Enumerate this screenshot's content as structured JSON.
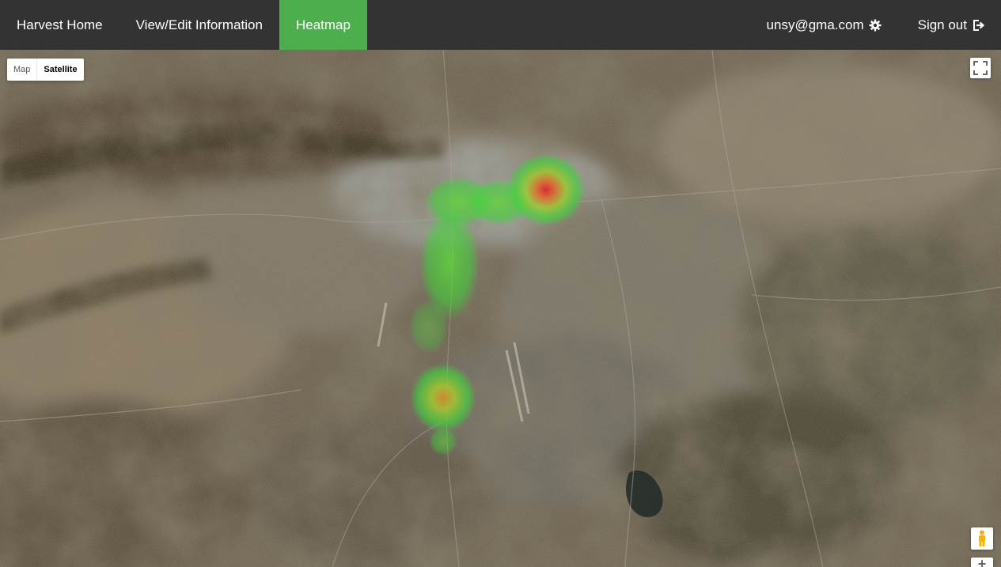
{
  "nav": {
    "home_label": "Harvest Home",
    "edit_label": "View/Edit Information",
    "heatmap_label": "Heatmap",
    "user_label": "unsy@gma.com",
    "signout_label": "Sign out",
    "active_item": "Heatmap",
    "active_color": "#4cae4c",
    "background_color": "#333333"
  },
  "map": {
    "type_control": {
      "map_label": "Map",
      "satellite_label": "Satellite",
      "selected": "Satellite"
    },
    "fullscreen_icon": "fullscreen-icon",
    "streetview_icon": "pegman-icon",
    "zoom_in_label": "+"
  }
}
